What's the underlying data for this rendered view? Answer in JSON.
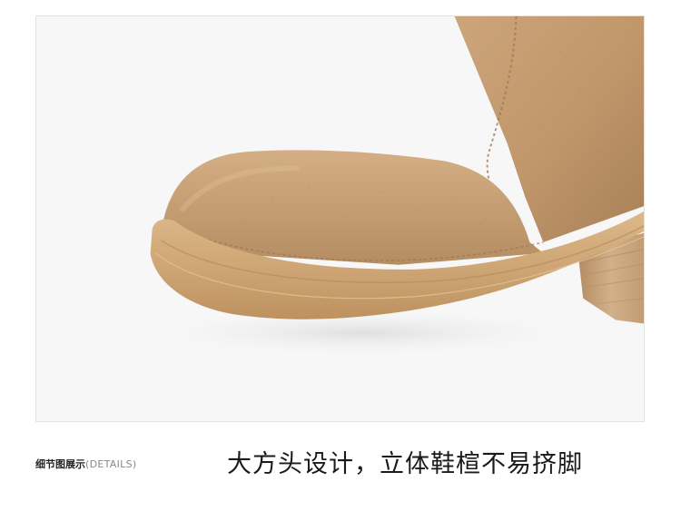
{
  "product_photo": {
    "alt": "suede ankle boot toe detail",
    "colors": {
      "background": "#f7f7f7",
      "suede": "#c39a6c",
      "suede_shadow": "#a7805a",
      "sole": "#d2ac7e",
      "sole_edge": "#b88f63",
      "heel_wood": "#c9a57c"
    }
  },
  "section_label": {
    "chinese": "细节图展示",
    "english": "(DETAILS)"
  },
  "caption": {
    "text": "大方头设计，立体鞋楦不易挤脚"
  }
}
